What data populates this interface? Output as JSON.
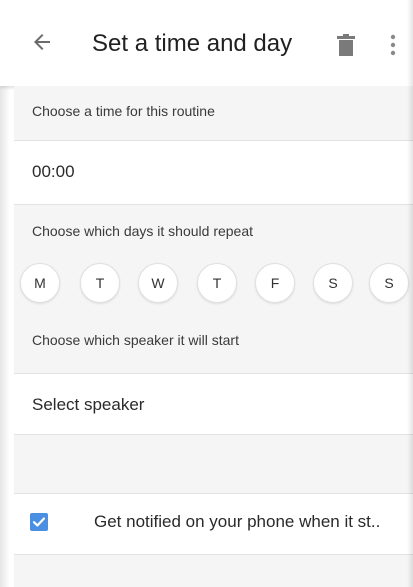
{
  "header": {
    "title": "Set a time and day",
    "back_icon": "arrow-back-icon",
    "delete_icon": "trash-icon",
    "more_icon": "more-vert-icon"
  },
  "time_section": {
    "label": "Choose a time for this routine",
    "value": "00:00"
  },
  "days_section": {
    "label": "Choose which days it should repeat",
    "days": [
      "M",
      "T",
      "W",
      "T",
      "F",
      "S",
      "S"
    ]
  },
  "speaker_section": {
    "label": "Choose which speaker it will start",
    "value": "Select speaker"
  },
  "notify": {
    "checked": true,
    "label": "Get notified on your phone when it st.."
  },
  "colors": {
    "accent": "#4a8fe2",
    "section_background": "#f5f5f5"
  }
}
